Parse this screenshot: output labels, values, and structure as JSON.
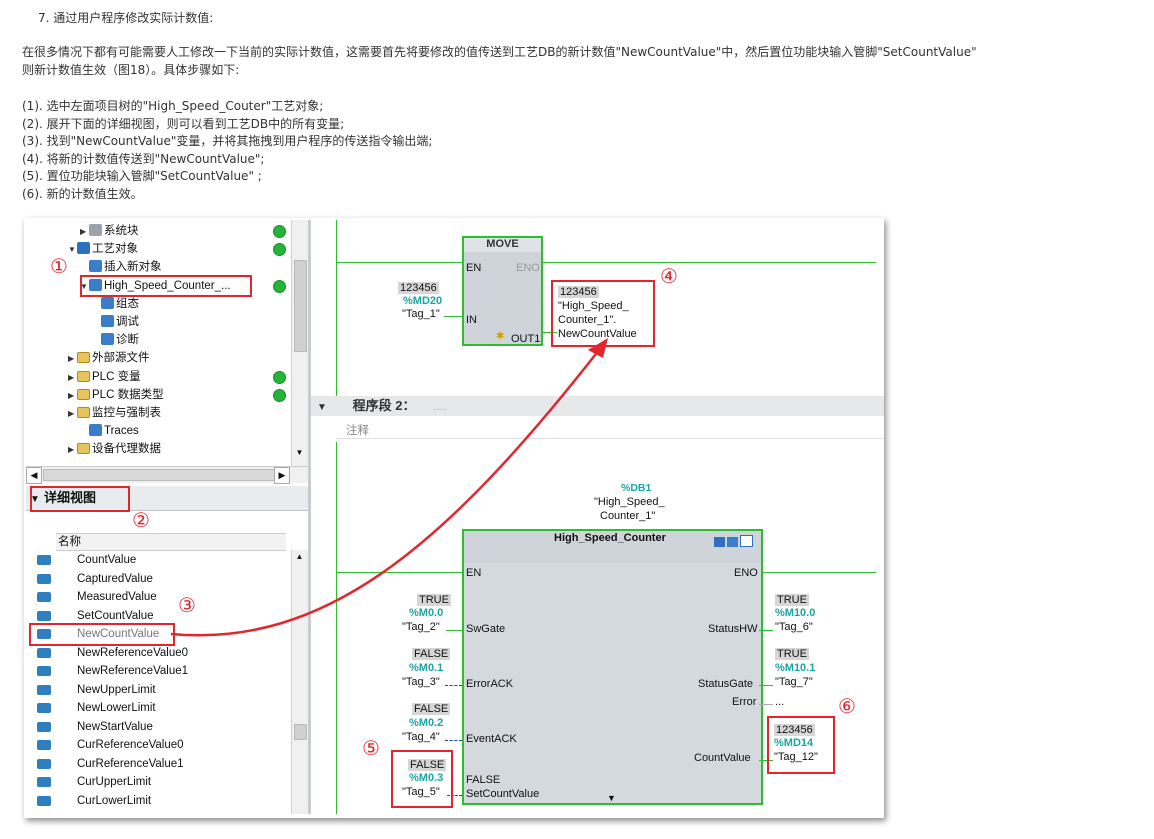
{
  "doc": {
    "heading": "7. 通过用户程序修改实际计数值:",
    "intro": "在很多情况下都有可能需要人工修改一下当前的实际计数值，这需要首先将要修改的值传送到工艺DB的新计数值\"NewCountValue\"中，然后置位功能块输入管脚\"SetCountValue\" 则新计数值生效（图18）。具体步骤如下:",
    "steps": [
      "(1). 选中左面项目树的\"High_Speed_Couter\"工艺对象;",
      "(2). 展开下面的详细视图，则可以看到工艺DB中的所有变量;",
      "(3). 找到\"NewCountValue\"变量，并将其拖拽到用户程序的传送指令输出端;",
      "(4). 将新的计数值传送到\"NewCountValue\";",
      "(5). 置位功能块输入管脚\"SetCountValue\" ;",
      "(6). 新的计数值生效。"
    ]
  },
  "tree": {
    "items": [
      {
        "label": "系统块",
        "indent": 2,
        "arrow": "▶",
        "icon": "grey",
        "dot": true
      },
      {
        "label": "工艺对象",
        "indent": 1,
        "arrow": "▼",
        "icon": "tech",
        "dot": true
      },
      {
        "label": "插入新对象",
        "indent": 2,
        "arrow": "",
        "icon": "blue",
        "dot": false
      },
      {
        "label": "High_Speed_Counter_...",
        "indent": 2,
        "arrow": "▼",
        "icon": "blue",
        "dot": true
      },
      {
        "label": "组态",
        "indent": 3,
        "arrow": "",
        "icon": "blue",
        "dot": false
      },
      {
        "label": "调试",
        "indent": 3,
        "arrow": "",
        "icon": "blue",
        "dot": false
      },
      {
        "label": "诊断",
        "indent": 3,
        "arrow": "",
        "icon": "blue",
        "dot": false
      },
      {
        "label": "外部源文件",
        "indent": 1,
        "arrow": "▶",
        "icon": "fold",
        "dot": false
      },
      {
        "label": "PLC 变量",
        "indent": 1,
        "arrow": "▶",
        "icon": "fold",
        "dot": true
      },
      {
        "label": "PLC 数据类型",
        "indent": 1,
        "arrow": "▶",
        "icon": "fold",
        "dot": true
      },
      {
        "label": "监控与强制表",
        "indent": 1,
        "arrow": "▶",
        "icon": "fold",
        "dot": false
      },
      {
        "label": "Traces",
        "indent": 2,
        "arrow": "",
        "icon": "blue",
        "dot": false
      },
      {
        "label": "设备代理数据",
        "indent": 1,
        "arrow": "▶",
        "icon": "fold",
        "dot": false
      }
    ]
  },
  "detail": {
    "title": "详细视图",
    "col_name": "名称",
    "vars": [
      "CountValue",
      "CapturedValue",
      "MeasuredValue",
      "SetCountValue",
      "NewCountValue",
      "NewReferenceValue0",
      "NewReferenceValue1",
      "NewUpperLimit",
      "NewLowerLimit",
      "NewStartValue",
      "CurReferenceValue0",
      "CurReferenceValue1",
      "CurUpperLimit",
      "CurLowerLimit"
    ]
  },
  "ladder": {
    "move": {
      "title": "MOVE",
      "en": "EN",
      "eno": "ENO",
      "in": "IN",
      "out": "OUT1",
      "in_val": "123456",
      "in_addr": "%MD20",
      "in_tag": "\"Tag_1\"",
      "out_val": "123456",
      "out_tag1": "\"High_Speed_",
      "out_tag2": "Counter_1\".",
      "out_tag3": "NewCountValue"
    },
    "segment": {
      "label": "程序段 2：",
      "dots": ".....",
      "comment": "注释"
    },
    "db": {
      "addr": "%DB1",
      "name1": "\"High_Speed_",
      "name2": "Counter_1\""
    },
    "fb": {
      "title": "High_Speed_Counter",
      "en": "EN",
      "eno": "ENO",
      "inputs": [
        {
          "pin": "SwGate",
          "val": "TRUE",
          "addr": "%M0.0",
          "tag": "\"Tag_2\""
        },
        {
          "pin": "ErrorACK",
          "val": "FALSE",
          "addr": "%M0.1",
          "tag": "\"Tag_3\""
        },
        {
          "pin": "EventACK",
          "val": "FALSE",
          "addr": "%M0.2",
          "tag": "\"Tag_4\""
        },
        {
          "pin": "SetCountValue",
          "val": "FALSE",
          "addr": "%M0.3",
          "tag": "\"Tag_5\"",
          "inner": "FALSE"
        }
      ],
      "outputs": [
        {
          "pin": "StatusHW",
          "val": "TRUE",
          "addr": "%M10.0",
          "tag": "\"Tag_6\""
        },
        {
          "pin": "StatusGate",
          "val": "TRUE",
          "addr": "%M10.1",
          "tag": "\"Tag_7\""
        },
        {
          "pin": "Error",
          "tag": "..."
        },
        {
          "pin": "CountValue",
          "val": "123456",
          "addr": "%MD14",
          "tag": "\"Tag_12\""
        }
      ]
    }
  },
  "callouts": [
    "①",
    "②",
    "③",
    "④",
    "⑤",
    "⑥"
  ],
  "colors": {
    "green": "#2ebd2e",
    "red": "#e0262e",
    "teal": "#1aa5a5"
  }
}
